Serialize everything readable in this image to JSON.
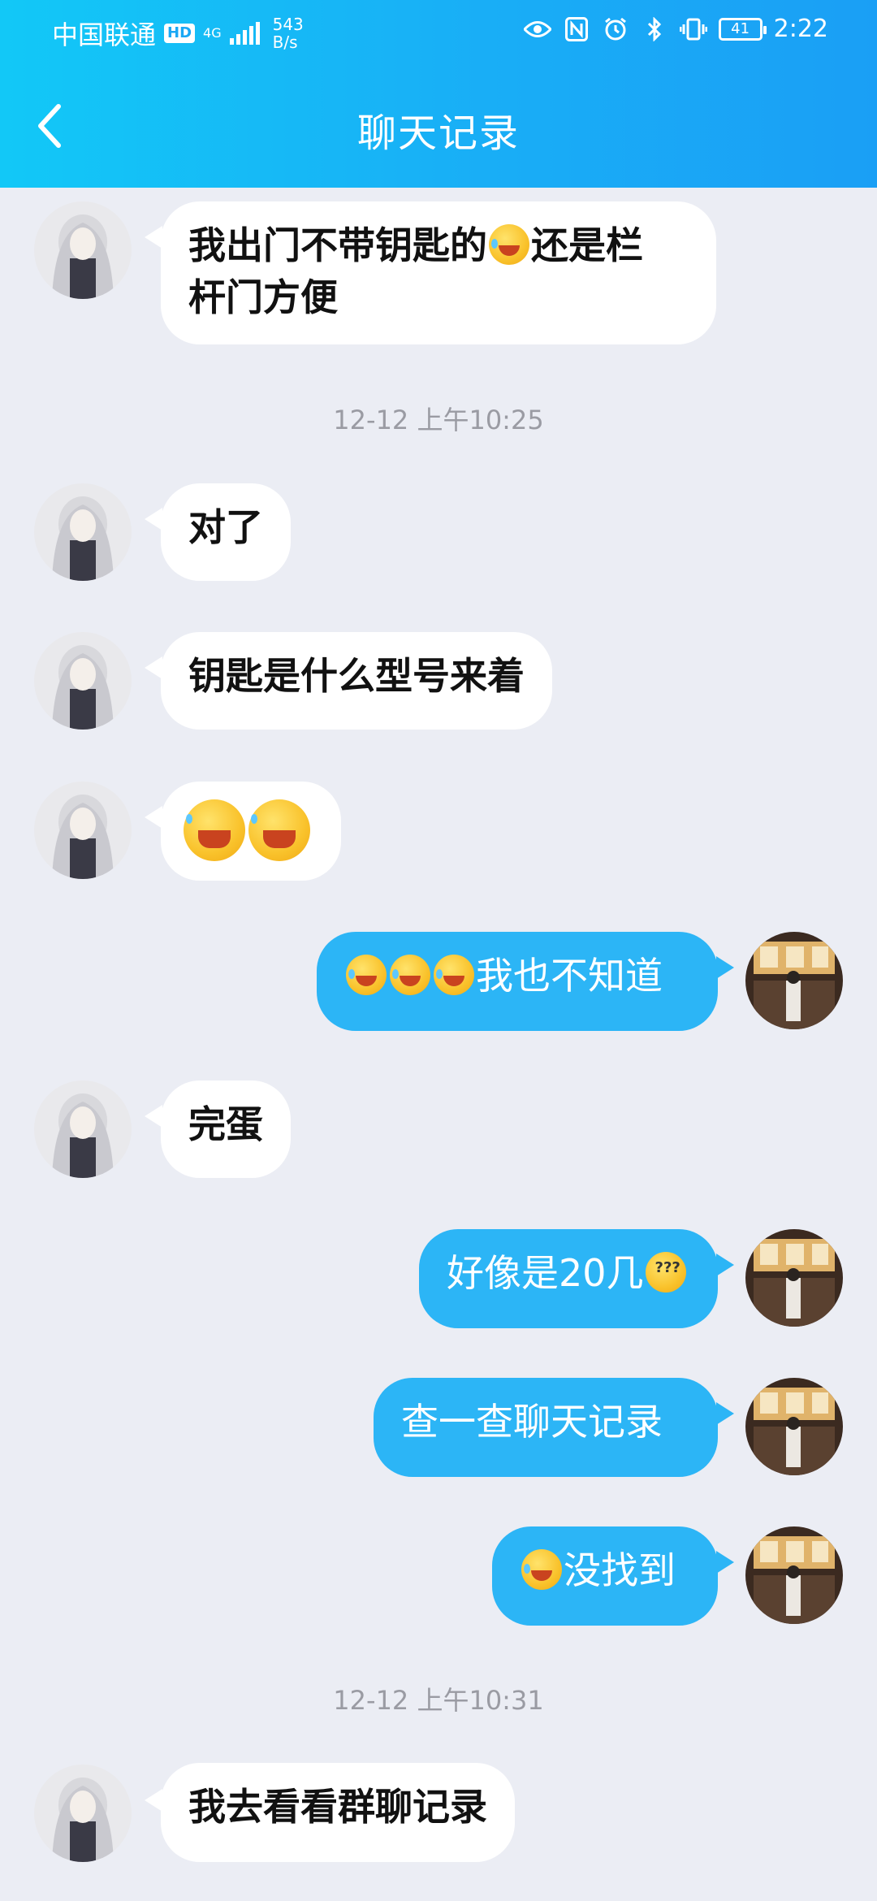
{
  "status_bar": {
    "carrier": "中国联通",
    "hd": "HD",
    "network": "4G",
    "speed_value": "543",
    "speed_unit": "B/s",
    "battery": "41",
    "time": "2:22"
  },
  "header": {
    "title": "聊天记录"
  },
  "messages": [
    {
      "side": "left",
      "text": "我出门不带钥匙的",
      "emoji_after": "laugh-cry",
      "text2": "还是栏",
      "line2": "杆门方便"
    },
    {
      "timestamp": "12-12 上午10:25"
    },
    {
      "side": "left",
      "text": "对了"
    },
    {
      "side": "left",
      "text": "钥匙是什么型号来着"
    },
    {
      "side": "left",
      "emoji_only": [
        "facepalm",
        "facepalm"
      ]
    },
    {
      "side": "right",
      "text": "我也不知道",
      "emoji_before": [
        "laugh-cry",
        "laugh-cry",
        "laugh-cry"
      ]
    },
    {
      "side": "left",
      "text": "完蛋"
    },
    {
      "side": "right",
      "text": "好像是20几",
      "emoji_after": "confused"
    },
    {
      "side": "right",
      "text": "查一查聊天记录"
    },
    {
      "side": "right",
      "text": "没找到",
      "emoji_before": [
        "facepalm"
      ]
    },
    {
      "timestamp": "12-12 上午10:31"
    },
    {
      "side": "left",
      "text": "我去看看群聊记录"
    }
  ],
  "colors": {
    "header_start": "#12c8f7",
    "header_end": "#1a9ff5",
    "background": "#ebedf4",
    "bubble_self": "#2cb5f6",
    "bubble_other": "#ffffff",
    "timestamp": "#9a9ba3"
  },
  "icons": {
    "back": "chevron-left-icon",
    "eye": "eye-icon",
    "nfc": "nfc-icon",
    "alarm": "alarm-icon",
    "bluetooth": "bluetooth-icon",
    "vibrate": "vibrate-icon"
  }
}
